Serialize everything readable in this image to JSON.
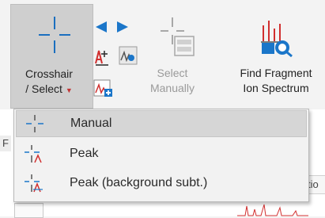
{
  "ribbon": {
    "crosshair_button": {
      "line1": "Crosshair",
      "line2": "/ Select"
    },
    "select_manually": {
      "line1": "Select",
      "line2": "Manually"
    },
    "find_fragment": {
      "line1": "Find Fragment",
      "line2": "Ion Spectrum"
    }
  },
  "menu": {
    "items": [
      {
        "label": "Manual",
        "icon": "crosshair-manual-icon",
        "highlighted": true
      },
      {
        "label": "Peak",
        "icon": "crosshair-peak-icon",
        "highlighted": false
      },
      {
        "label": "Peak (background subt.)",
        "icon": "crosshair-peak-background-icon",
        "highlighted": false
      }
    ]
  },
  "background_peek": {
    "left_char": "F",
    "right_text": "tio"
  },
  "colors": {
    "accent_blue": "#1b76c9",
    "accent_red": "#d12f2f",
    "pressed_bg": "#cfcfcf",
    "highlight_bg": "#d6d6d6"
  }
}
